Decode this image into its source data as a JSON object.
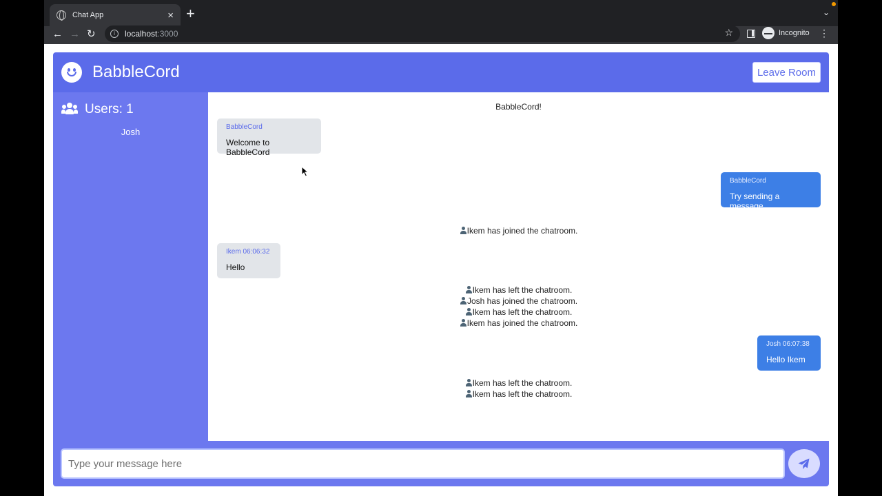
{
  "browser": {
    "tab_title": "Chat App",
    "url_host": "localhost",
    "url_port": ":3000",
    "incognito_label": "Incognito"
  },
  "app": {
    "brand": "BabbleCord",
    "leave_label": "Leave Room",
    "accent": "#5b6bea"
  },
  "sidebar": {
    "users_label": "Users: 1",
    "users": [
      "Josh"
    ]
  },
  "messages": {
    "banner": "BabbleCord!",
    "m1": {
      "sender": "BabbleCord",
      "text": "Welcome to BabbleCord"
    },
    "m2": {
      "sender": "BabbleCord",
      "text": "Try sending a message"
    },
    "n1": "Ikem has joined the chatroom.",
    "m3": {
      "meta": "Ikem 06:06:32",
      "text": "Hello"
    },
    "n2": "Ikem has left the chatroom.",
    "n3": "Josh has joined the chatroom.",
    "n4": "Ikem has left the chatroom.",
    "n5": "Ikem has joined the chatroom.",
    "m4": {
      "meta": "Josh 06:07:38",
      "text": "Hello Ikem"
    },
    "n6": "Ikem has left the chatroom.",
    "n7": "Ikem has left the chatroom."
  },
  "composer": {
    "placeholder": "Type your message here",
    "value": ""
  }
}
